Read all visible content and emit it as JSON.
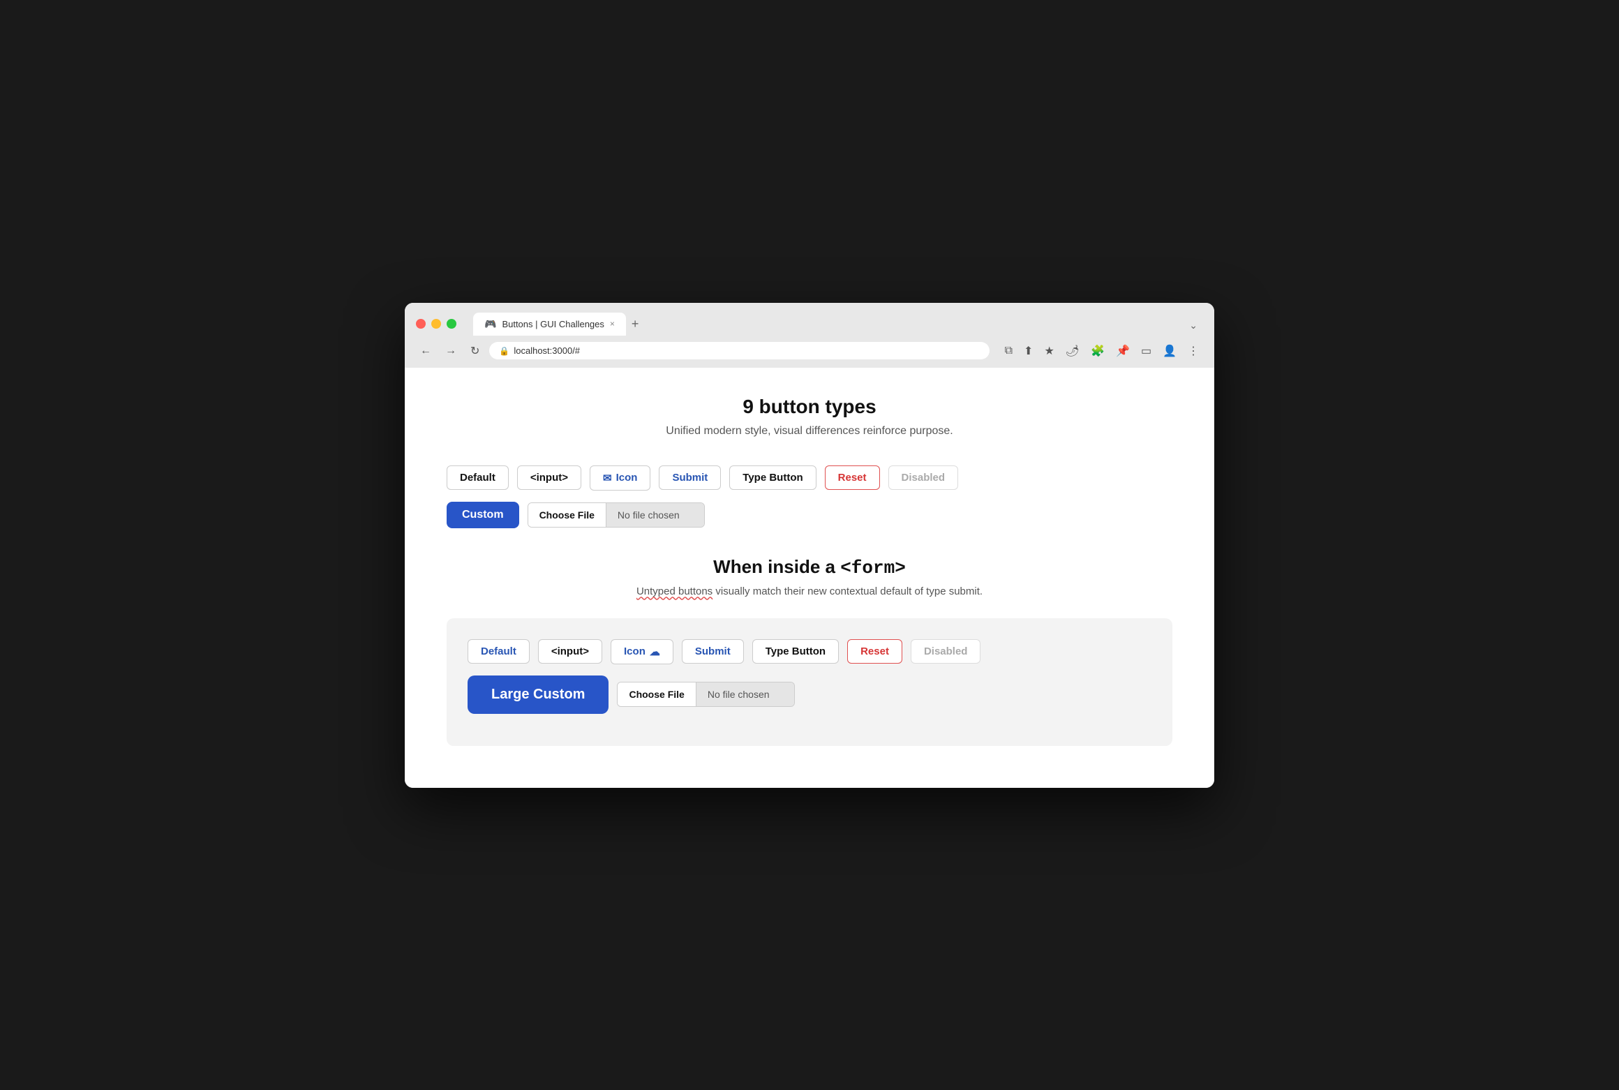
{
  "browser": {
    "url": "localhost:3000/#",
    "tab_title": "Buttons | GUI Challenges",
    "tab_icon": "🎮",
    "tab_close": "×",
    "new_tab": "+",
    "expand_icon": "⌄",
    "nav": {
      "back": "←",
      "forward": "→",
      "reload": "↻"
    },
    "actions": {
      "open_external": "⧉",
      "share": "⬆",
      "bookmark": "★",
      "extension1": "🌶",
      "puzzle": "🧩",
      "pin": "📌",
      "sidebar": "▭",
      "profile": "👤",
      "more": "⋮"
    }
  },
  "page": {
    "title": "9 button types",
    "subtitle": "Unified modern style, visual differences reinforce purpose."
  },
  "section1": {
    "buttons": {
      "default": "Default",
      "input": "<input>",
      "icon": "Icon",
      "submit": "Submit",
      "type_button": "Type Button",
      "reset": "Reset",
      "disabled": "Disabled",
      "custom": "Custom",
      "choose_file": "Choose File",
      "no_file_chosen": "No file chosen"
    }
  },
  "section2": {
    "title": "When inside a ",
    "title_code": "<form>",
    "subtitle_part1": "Untyped buttons",
    "subtitle_part2": " visually match their new contextual default of type submit.",
    "buttons": {
      "default": "Default",
      "input": "<input>",
      "icon": "Icon",
      "submit": "Submit",
      "type_button": "Type Button",
      "reset": "Reset",
      "disabled": "Disabled",
      "large_custom": "Large Custom",
      "choose_file": "Choose File",
      "no_file_chosen": "No file chosen"
    },
    "cloud_icon": "☁"
  },
  "colors": {
    "blue": "#2855c8",
    "blue_text": "#2855b3",
    "red": "#d63535",
    "red_border": "#e05050"
  }
}
